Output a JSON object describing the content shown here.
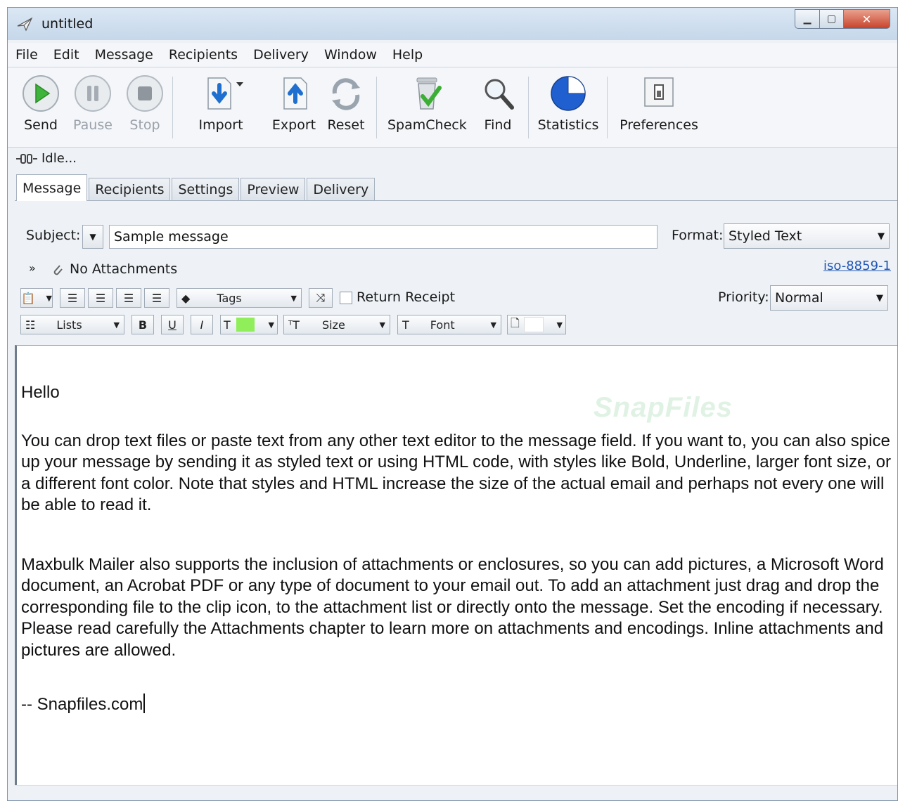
{
  "window": {
    "title": "untitled"
  },
  "menu": [
    "File",
    "Edit",
    "Message",
    "Recipients",
    "Delivery",
    "Window",
    "Help"
  ],
  "toolbar": {
    "send": "Send",
    "pause": "Pause",
    "stop": "Stop",
    "import": "Import",
    "export": "Export",
    "reset": "Reset",
    "spamcheck": "SpamCheck",
    "find": "Find",
    "statistics": "Statistics",
    "preferences": "Preferences"
  },
  "status": {
    "text": "Idle..."
  },
  "tabs": [
    "Message",
    "Recipients",
    "Settings",
    "Preview",
    "Delivery"
  ],
  "form": {
    "subject_label": "Subject:",
    "subject_value": "Sample message",
    "format_label": "Format:",
    "format_value": "Styled Text",
    "attachments": "No Attachments",
    "encoding": "iso-8859-1",
    "tags": "Tags",
    "return_receipt": "Return Receipt",
    "priority_label": "Priority:",
    "priority_value": "Normal",
    "lists": "Lists",
    "bold": "B",
    "underline": "U",
    "italic": "I",
    "size": "Size",
    "font": "Font"
  },
  "colors": {
    "text_highlight": "#90ee5a",
    "accent": "#1f56b5"
  },
  "message": {
    "p1": "Hello",
    "p2": "You can drop text files or paste text from any other text editor to the message field. If you want to, you can also spice up your message by sending it as styled text or using HTML code, with styles like Bold, Underline, larger font size, or a different font color. Note that styles and HTML increase the size of the actual email and perhaps not every one will be able to read it.",
    "p3": "Maxbulk Mailer also supports the inclusion of attachments or enclosures, so you can add pictures, a Microsoft Word document, an Acrobat PDF or any type of document to your email out. To add an attachment just drag and drop the corresponding file to the clip icon, to the attachment list or directly onto the message. Set the encoding if necessary. Please read carefully the Attachments chapter to learn more on attachments and encodings. Inline attachments and pictures are allowed.",
    "p4": "-- Snapfiles.com",
    "watermark": "SnapFiles"
  }
}
